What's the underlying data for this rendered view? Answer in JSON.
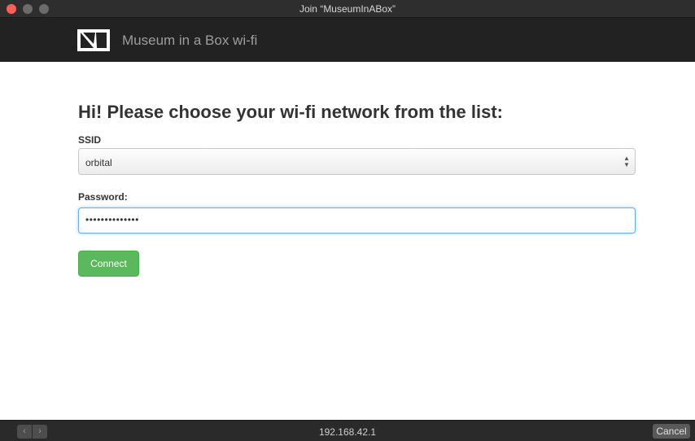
{
  "window": {
    "title": "Join “MuseumInABox”"
  },
  "navbar": {
    "brand": "Museum in a Box wi-fi",
    "logo_icon": "museum-in-a-box-logo"
  },
  "form": {
    "heading": "Hi! Please choose your wi-fi network from the list:",
    "ssid_label": "SSID",
    "ssid_value": "orbital",
    "password_label": "Password:",
    "password_value": "••••••••••••••",
    "connect_label": "Connect"
  },
  "bottombar": {
    "back_icon": "‹",
    "forward_icon": "›",
    "address": "192.168.42.1",
    "cancel_label": "Cancel"
  },
  "colors": {
    "navbar_bg": "#222222",
    "connect_green": "#5cb85c",
    "focus_blue": "#66afe9",
    "close_red": "#ff5f57"
  }
}
